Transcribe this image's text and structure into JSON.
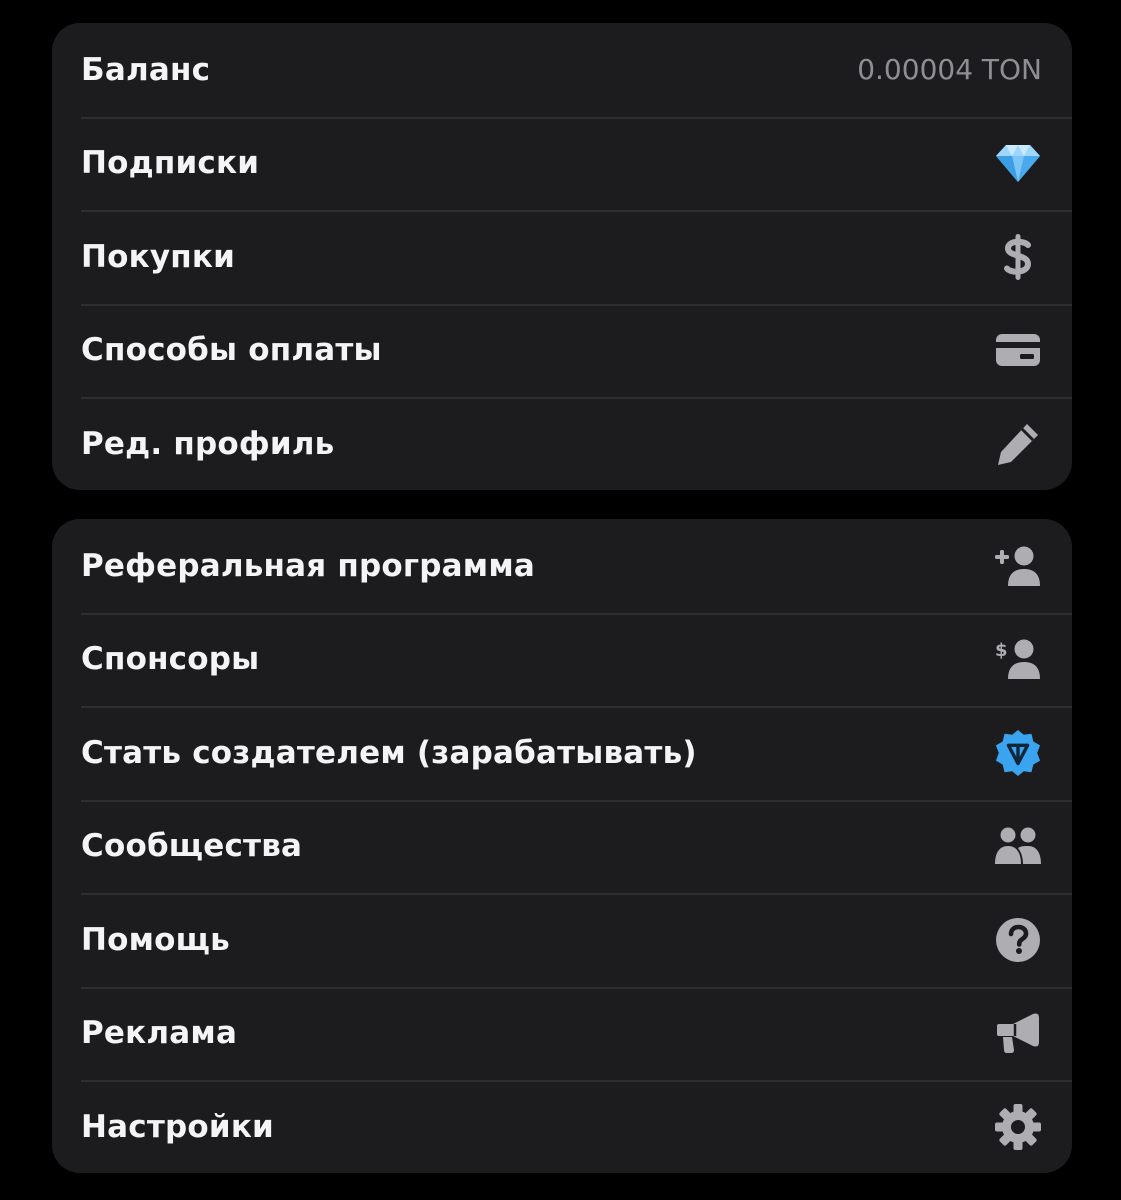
{
  "group_account": {
    "balance_label": "Баланс",
    "balance_value": "0.00004 TON",
    "subscriptions_label": "Подписки",
    "purchases_label": "Покупки",
    "payment_methods_label": "Способы оплаты",
    "edit_profile_label": "Ред. профиль"
  },
  "group_more": {
    "referral_label": "Реферальная программа",
    "sponsors_label": "Спонсоры",
    "become_creator_label": "Стать создателем (зарабатывать)",
    "communities_label": "Сообщества",
    "help_label": "Помощь",
    "ads_label": "Реклама",
    "settings_label": "Настройки"
  },
  "icons": {
    "subscriptions": "diamond-icon",
    "purchases": "dollar-icon",
    "payment_methods": "credit-card-icon",
    "edit_profile": "pencil-icon",
    "referral": "user-plus-icon",
    "sponsors": "user-dollar-icon",
    "become_creator": "verified-ton-badge-icon",
    "communities": "users-icon",
    "help": "question-circle-icon",
    "ads": "megaphone-icon",
    "settings": "gear-icon"
  },
  "colors": {
    "background": "#000000",
    "card": "#1c1c1e",
    "divider": "#2e2e31",
    "label": "#f4f4f6",
    "secondary": "#8e8e93",
    "icon": "#aeaeb2",
    "accent_blue": "#3aa4f0"
  }
}
